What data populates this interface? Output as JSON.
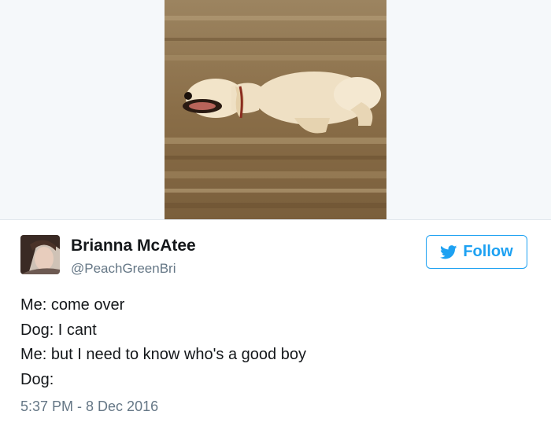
{
  "author": {
    "name": "Brianna McAtee",
    "handle": "@PeachGreenBri"
  },
  "follow": {
    "label": "Follow",
    "icon": "twitter-bird-icon"
  },
  "tweet": {
    "lines": [
      "Me: come over",
      "Dog: I cant",
      "Me: but I need to know who's a good boy",
      "Dog:"
    ],
    "timestamp": "5:37 PM - 8 Dec 2016"
  },
  "colors": {
    "accent": "#1da1f2",
    "secondary_text": "#657786",
    "primary_text": "#14171a",
    "media_background": "#f5f8fa"
  }
}
